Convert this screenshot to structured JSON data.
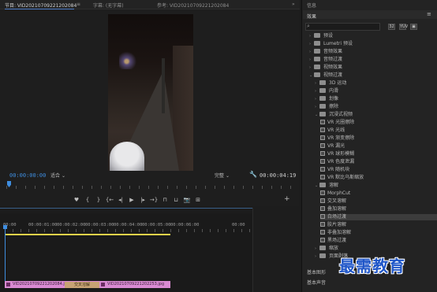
{
  "monitor": {
    "tabs": [
      {
        "label": "节目: VID20210709221202084",
        "active": true
      },
      {
        "label": "字幕: (无字幕)",
        "active": false
      },
      {
        "label": "参考: VID20210709221202084",
        "active": false
      }
    ],
    "menu_icon": "≡",
    "timecode_current": "00:00:00:00",
    "fit_value": "适合",
    "quality_value": "完整",
    "timecode_duration": "00:00:04:19",
    "transport": {
      "buttons": [
        "marker-icon",
        "in-point-icon",
        "out-point-icon",
        "go-to-in-icon",
        "step-back-icon",
        "play-icon",
        "step-forward-icon",
        "go-to-out-icon",
        "lift-icon",
        "extract-icon",
        "export-frame-icon",
        "compare-icon"
      ],
      "glyphs": [
        "♥",
        "{",
        "}",
        "{←",
        "◂|",
        "▶",
        "|▸",
        "→}",
        "⊓",
        "⊔",
        "📷",
        "⊞"
      ],
      "add": "+"
    }
  },
  "timeline": {
    "timecodes": [
      "00:00",
      "00:00:01:00",
      "00:00:02:00",
      "00:00:03:00",
      "00:00:04:00",
      "00:00:05:00",
      "00:00:06:00",
      "00:00"
    ],
    "clips": [
      {
        "label": "VID20210709221202084.jpg"
      },
      {
        "label": "VID20210709221202253.jpg"
      }
    ],
    "transition_label": "交叉溶解",
    "accent": "#3f8ee0",
    "clip_color": "#d98ad2"
  },
  "panel": {
    "info_label": "信息",
    "effects_label": "效果",
    "menu_icon": "≡",
    "filter_buttons": [
      "32",
      "YUV",
      "▣"
    ],
    "effects_tree": [
      {
        "label": "预设",
        "level": 0,
        "kind": "folder",
        "expanded": false
      },
      {
        "label": "Lumetri 预设",
        "level": 0,
        "kind": "folder",
        "expanded": false
      },
      {
        "label": "音频效果",
        "level": 0,
        "kind": "folder",
        "expanded": false
      },
      {
        "label": "音频过渡",
        "level": 0,
        "kind": "folder",
        "expanded": false
      },
      {
        "label": "视频效果",
        "level": 0,
        "kind": "folder",
        "expanded": false
      },
      {
        "label": "视频过渡",
        "level": 0,
        "kind": "folder",
        "expanded": true
      },
      {
        "label": "3D 运动",
        "level": 1,
        "kind": "folder",
        "expanded": false
      },
      {
        "label": "内滑",
        "level": 1,
        "kind": "folder",
        "expanded": false
      },
      {
        "label": "划像",
        "level": 1,
        "kind": "folder",
        "expanded": false
      },
      {
        "label": "擦除",
        "level": 1,
        "kind": "folder",
        "expanded": false
      },
      {
        "label": "沉浸式视频",
        "level": 1,
        "kind": "folder",
        "expanded": true
      },
      {
        "label": "VR 光圈擦除",
        "level": 2,
        "kind": "effect"
      },
      {
        "label": "VR 光线",
        "level": 2,
        "kind": "effect"
      },
      {
        "label": "VR 渐变擦除",
        "level": 2,
        "kind": "effect"
      },
      {
        "label": "VR 漏光",
        "level": 2,
        "kind": "effect"
      },
      {
        "label": "VR 球形模糊",
        "level": 2,
        "kind": "effect"
      },
      {
        "label": "VR 色度泄漏",
        "level": 2,
        "kind": "effect"
      },
      {
        "label": "VR 随机块",
        "level": 2,
        "kind": "effect"
      },
      {
        "label": "VR 默比乌斯缩放",
        "level": 2,
        "kind": "effect"
      },
      {
        "label": "溶解",
        "level": 1,
        "kind": "folder",
        "expanded": true
      },
      {
        "label": "MorphCut",
        "level": 2,
        "kind": "effect"
      },
      {
        "label": "交叉溶解",
        "level": 2,
        "kind": "effect"
      },
      {
        "label": "叠加溶解",
        "level": 2,
        "kind": "effect"
      },
      {
        "label": "白场过渡",
        "level": 2,
        "kind": "effect",
        "selected": true
      },
      {
        "label": "胶片溶解",
        "level": 2,
        "kind": "effect"
      },
      {
        "label": "非叠加溶解",
        "level": 2,
        "kind": "effect"
      },
      {
        "label": "黑场过渡",
        "level": 2,
        "kind": "effect"
      },
      {
        "label": "缩放",
        "level": 1,
        "kind": "folder",
        "expanded": false
      },
      {
        "label": "页面剥落",
        "level": 1,
        "kind": "folder",
        "expanded": false
      }
    ],
    "bottom_items": [
      "基本图形",
      "基本声音"
    ]
  },
  "watermark": "最需教育"
}
